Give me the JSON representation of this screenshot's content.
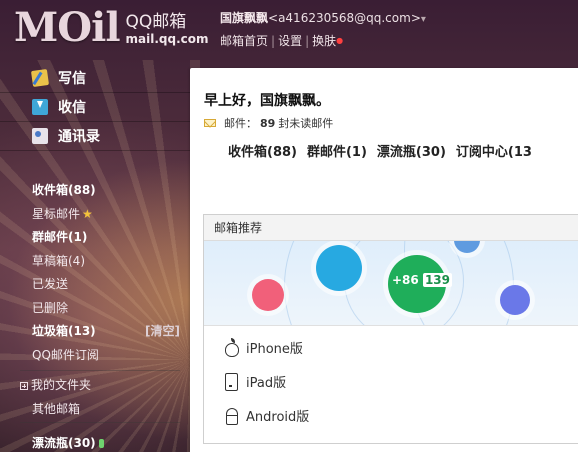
{
  "header": {
    "logo_mark": "MOil",
    "logo_title": "QQ邮箱",
    "logo_domain": "mail.qq.com",
    "nickname": "国旗飘飘",
    "email": "<a416230568@qq.com>",
    "dropdown_arrow": "▾",
    "links": [
      "邮箱首页",
      "设置",
      "换肤"
    ],
    "separator": "|"
  },
  "sidebar": {
    "nav": [
      {
        "label": "写信",
        "icon": "write-icon"
      },
      {
        "label": "收信",
        "icon": "inbox-download-icon"
      },
      {
        "label": "通讯录",
        "icon": "contacts-icon"
      }
    ],
    "folders": [
      {
        "label": "收件箱(88)",
        "bold": true
      },
      {
        "label": "星标邮件",
        "star": "★"
      },
      {
        "label": "群邮件(1)",
        "bold": true
      },
      {
        "label": "草稿箱(4)"
      },
      {
        "label": "已发送"
      },
      {
        "label": "已删除"
      },
      {
        "label": "垃圾箱(13)",
        "bold": true,
        "extra": "[清空]"
      },
      {
        "label": "QQ邮件订阅"
      }
    ],
    "my_folders": "我的文件夹",
    "other_mail": "其他邮箱",
    "drift": "漂流瓶(30)"
  },
  "main": {
    "greeting": "早上好，国旗飘飘。",
    "unread_prefix": "邮件：",
    "unread_count": "89",
    "unread_suffix": "封未读邮件",
    "quick_links": [
      "收件箱(88)",
      "群邮件(1)",
      "漂流瓶(30)",
      "订阅中心(13"
    ],
    "recommend_title": "邮箱推荐",
    "phone_prefix": "+86",
    "phone_num": "139",
    "platforms": [
      {
        "label": "iPhone版",
        "icon": "apple-icon"
      },
      {
        "label": "iPad版",
        "icon": "ipad-icon"
      },
      {
        "label": "Android版",
        "icon": "android-icon"
      }
    ]
  },
  "colors": {
    "accent_green": "#1fae5a",
    "accent_blue": "#27a9e1",
    "accent_pink": "#f1607a",
    "accent_purple": "#6a78e8"
  }
}
